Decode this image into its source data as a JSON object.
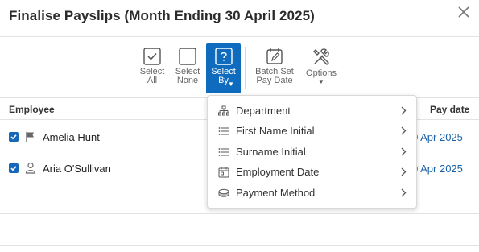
{
  "dialog": {
    "title": "Finalise Payslips (Month Ending 30 April 2025)"
  },
  "toolbar": {
    "select_all": "Select\nAll",
    "select_none": "Select\nNone",
    "select_by": "Select\nBy",
    "batch_set_pay_date": "Batch Set\nPay Date",
    "options": "Options"
  },
  "table": {
    "columns": {
      "employee": "Employee",
      "pay_date": "Pay date"
    },
    "rows": [
      {
        "name": "Amelia Hunt",
        "pay_date": "0 Apr 2025",
        "icon": "flag-icon",
        "checked": true
      },
      {
        "name": "Aria O'Sullivan",
        "pay_date": "0 Apr 2025",
        "icon": "person-icon",
        "checked": true
      }
    ]
  },
  "select_by_menu": {
    "items": [
      {
        "label": "Department",
        "icon": "org-chart-icon"
      },
      {
        "label": "First Name Initial",
        "icon": "list-icon"
      },
      {
        "label": "Surname Initial",
        "icon": "list-icon"
      },
      {
        "label": "Employment Date",
        "icon": "calendar-icon"
      },
      {
        "label": "Payment Method",
        "icon": "coins-icon"
      }
    ]
  },
  "colors": {
    "accent": "#0f6bbd",
    "link": "#1a62a8",
    "checkbox": "#1667b8"
  }
}
